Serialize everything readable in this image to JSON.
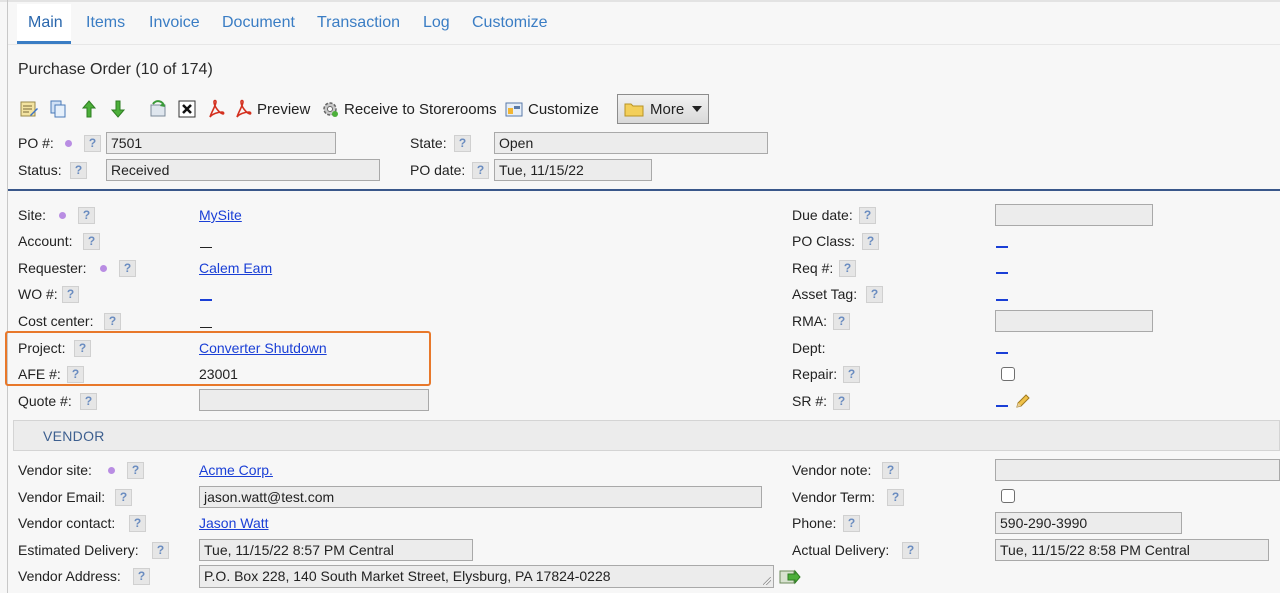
{
  "tabs": [
    {
      "label": "Main",
      "active": true
    },
    {
      "label": "Items"
    },
    {
      "label": "Invoice"
    },
    {
      "label": "Document"
    },
    {
      "label": "Transaction"
    },
    {
      "label": "Log"
    },
    {
      "label": "Customize"
    }
  ],
  "page_title": "Purchase Order (10 of 174)",
  "toolbar": {
    "icons": [
      "edit-icon",
      "copy-icon",
      "up-arrow-icon",
      "down-arrow-icon",
      "refresh-icon",
      "delete-icon",
      "pdf-icon",
      "pdf-preview-icon",
      "gear-icon",
      "customize-icon",
      "folder-icon"
    ],
    "preview_label": "Preview",
    "receive_label": "Receive to Storerooms",
    "customize_label": "Customize",
    "more_label": "More"
  },
  "header_fields": {
    "po_label": "PO #:",
    "po_value": "7501",
    "state_label": "State:",
    "state_value": "Open",
    "status_label": "Status:",
    "status_value": "Received",
    "po_date_label": "PO date:",
    "po_date_value": "Tue, 11/15/22"
  },
  "help_glyph": "?",
  "left_fields": {
    "site_label": "Site:",
    "site_value": "MySite",
    "account_label": "Account:",
    "requester_label": "Requester:",
    "requester_value": "Calem Eam",
    "wo_label": "WO #:",
    "cost_center_label": "Cost center:",
    "project_label": "Project:",
    "project_value": "Converter Shutdown",
    "afe_label": "AFE #:",
    "afe_value": "23001",
    "quote_label": "Quote #:",
    "quote_value": ""
  },
  "right_fields": {
    "due_date_label": "Due date:",
    "due_date_value": "",
    "po_class_label": "PO Class:",
    "req_label": "Req #:",
    "asset_tag_label": "Asset Tag:",
    "rma_label": "RMA:",
    "rma_value": "",
    "dept_label": "Dept:",
    "repair_label": "Repair:",
    "repair_checked": false,
    "sr_label": "SR #:"
  },
  "vendor_section": {
    "title": "VENDOR",
    "vendor_site_label": "Vendor site:",
    "vendor_site_value": "Acme Corp.",
    "vendor_email_label": "Vendor Email:",
    "vendor_email_value": "jason.watt@test.com",
    "vendor_contact_label": "Vendor contact:",
    "vendor_contact_value": "Jason Watt",
    "est_delivery_label": "Estimated Delivery:",
    "est_delivery_value": "Tue, 11/15/22 8:57 PM Central",
    "vendor_address_label": "Vendor Address:",
    "vendor_address_value": "P.O. Box 228, 140 South Market Street, Elysburg, PA 17824-0228",
    "vendor_note_label": "Vendor note:",
    "vendor_note_value": "",
    "vendor_term_label": "Vendor Term:",
    "vendor_term_checked": false,
    "phone_label": "Phone:",
    "phone_value": "590-290-3990",
    "actual_delivery_label": "Actual Delivery:",
    "actual_delivery_value": "Tue, 11/15/22 8:58 PM Central"
  },
  "colors": {
    "accent": "#3a7dc4",
    "link": "#1a3fd6",
    "highlight": "#e8782a",
    "required_dot": "#b98de3",
    "separator": "#39578a"
  }
}
